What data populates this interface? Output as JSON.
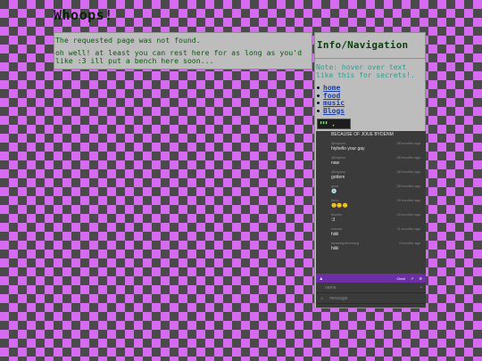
{
  "page": {
    "title": "Whoops!"
  },
  "main": {
    "line1": "The requested page was not found.",
    "line2": "oh well! at least you can rest here for as long as you'd like :3 ill put a bench here soon..."
  },
  "sidebar": {
    "title": "Info/Navigation",
    "note": "Note: hover over text like this for secrets!.",
    "nav": [
      "home",
      "food",
      "music",
      "Blogs"
    ]
  },
  "chat": {
    "messages": [
      {
        "name": "BECAUSE OF JOUE BYDENM",
        "time": "",
        "text": ""
      },
      {
        "name": "@raybux",
        "time": "28 months ago",
        "text": "hiyhello your gay"
      },
      {
        "name": "@raybux",
        "time": "28 months ago",
        "text": "naw"
      },
      {
        "name": "@raybux",
        "time": "28 months ago",
        "text": "gottem"
      },
      {
        "name": "guwi",
        "time": "28 months ago",
        "text": "💿"
      },
      {
        "name": "flenn",
        "time": "20 months ago",
        "text": "🙂🙂🙂"
      },
      {
        "name": "bluebo",
        "time": "15 months ago",
        "text": ":3"
      },
      {
        "name": "medna",
        "time": "11 months ago",
        "text": "hiiiii"
      },
      {
        "name": "tobeskip4eversvg",
        "time": "4 months ago",
        "text": "hiiiii"
      }
    ],
    "bar": {
      "clear": "Clear"
    },
    "name_placeholder": "name",
    "message_placeholder": "message"
  }
}
